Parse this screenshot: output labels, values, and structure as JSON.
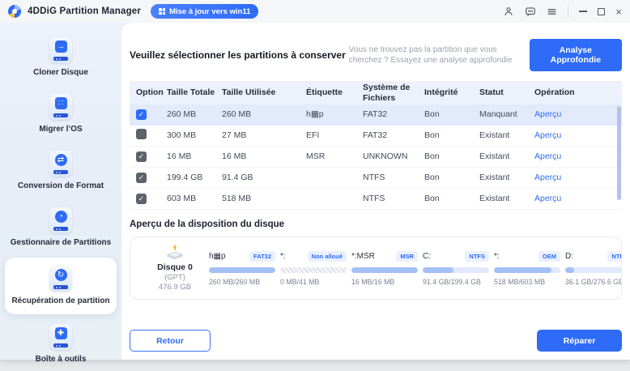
{
  "colors": {
    "accent": "#2e6bf6",
    "link": "#3370ff",
    "table_header_bg": "#edf1fc",
    "row_highlight": "#e2eafc",
    "badge_bg": "#e9f0ff",
    "bar_fill": "#a4c0f7"
  },
  "titlebar": {
    "app_name": "4DDiG Partition Manager",
    "upgrade_badge": "Mise à jour vers win11",
    "icons": [
      "user-icon",
      "feedback-icon",
      "menu-icon",
      "minimize-icon",
      "maximize-icon",
      "close-icon"
    ]
  },
  "sidebar": {
    "items": [
      {
        "label": "Cloner Disque",
        "icon": "clone-disk-icon",
        "active": false
      },
      {
        "label": "Migrer l’OS",
        "icon": "migrate-os-icon",
        "active": false
      },
      {
        "label": "Conversion de Format",
        "icon": "format-conversion-icon",
        "active": false
      },
      {
        "label": "Gestionnaire de Partitions",
        "icon": "partition-manager-icon",
        "active": false
      },
      {
        "label": "Récupération de partition",
        "icon": "partition-recovery-icon",
        "active": true
      },
      {
        "label": "Boîte à outils",
        "icon": "toolbox-icon",
        "active": false
      }
    ]
  },
  "main": {
    "title": "Veuillez sélectionner les partitions à conserver",
    "hint": "Vous ne trouvez pas la partition que vous cherchez ? Essayez une analyse approfondie",
    "deep_scan_button": "Analyse Approfondie",
    "table": {
      "columns": [
        "Option",
        "Taille Totale",
        "Taille Utilisée",
        "Étiquette",
        "Système de Fichiers",
        "Intégrité",
        "Statut",
        "Opération"
      ],
      "rows": [
        {
          "checked": true,
          "checkbox_style": "blue",
          "highlighted": true,
          "total": "260 MB",
          "used": "260 MB",
          "label": "h▦p",
          "fs": "FAT32",
          "integrity": "Bon",
          "status": "Manquant",
          "operation": "Aperçu"
        },
        {
          "checked": false,
          "checkbox_style": "dark",
          "highlighted": false,
          "total": "300 MB",
          "used": "27 MB",
          "label": "EFI",
          "fs": "FAT32",
          "integrity": "Bon",
          "status": "Existant",
          "operation": "Aperçu"
        },
        {
          "checked": true,
          "checkbox_style": "gray",
          "highlighted": false,
          "total": "16 MB",
          "used": "16 MB",
          "label": "MSR",
          "fs": "UNKNOWN",
          "integrity": "Bon",
          "status": "Existant",
          "operation": "Aperçu"
        },
        {
          "checked": true,
          "checkbox_style": "gray",
          "highlighted": false,
          "total": "199.4 GB",
          "used": "91.4 GB",
          "label": "",
          "fs": "NTFS",
          "integrity": "Bon",
          "status": "Existant",
          "operation": "Aperçu"
        },
        {
          "checked": true,
          "checkbox_style": "gray",
          "highlighted": false,
          "total": "603 MB",
          "used": "518 MB",
          "label": "",
          "fs": "NTFS",
          "integrity": "Bon",
          "status": "Existant",
          "operation": "Aperçu"
        }
      ]
    },
    "disk_layout": {
      "title": "Aperçu de la disposition du disque",
      "disk": {
        "name": "Disque 0",
        "type": "(GPT)",
        "size": "476.9 GB"
      },
      "partitions": [
        {
          "name": "h▦p",
          "badge": "FAT32",
          "usage": "260 MB/260 MB",
          "fill": 100,
          "style": "normal"
        },
        {
          "name": "*:",
          "badge": "Non alloué",
          "usage": "0 MB/41 MB",
          "fill": 0,
          "style": "unallocated"
        },
        {
          "name": "*:MSR",
          "badge": "MSR",
          "usage": "16 MB/16 MB",
          "fill": 100,
          "style": "normal"
        },
        {
          "name": "C:",
          "badge": "NTFS",
          "usage": "91.4 GB/199.4 GB",
          "fill": 46,
          "style": "normal"
        },
        {
          "name": "*:",
          "badge": "OEM",
          "usage": "518 MB/603 MB",
          "fill": 86,
          "style": "normal"
        },
        {
          "name": "D:",
          "badge": "NTFS",
          "usage": "36.1 GB/276.6 GB",
          "fill": 13,
          "style": "normal"
        }
      ]
    },
    "footer": {
      "back_button": "Retour",
      "repair_button": "Réparer"
    }
  }
}
